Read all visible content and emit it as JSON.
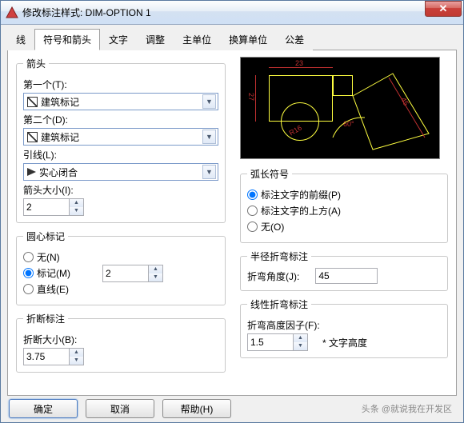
{
  "window": {
    "title": "修改标注样式: DIM-OPTION 1"
  },
  "tabs": [
    "线",
    "符号和箭头",
    "文字",
    "调整",
    "主单位",
    "换算单位",
    "公差"
  ],
  "active_tab": 1,
  "arrow": {
    "legend": "箭头",
    "first_label": "第一个(T):",
    "first_value": "建筑标记",
    "second_label": "第二个(D):",
    "second_value": "建筑标记",
    "leader_label": "引线(L):",
    "leader_value": "实心闭合",
    "size_label": "箭头大小(I):",
    "size_value": "2"
  },
  "center": {
    "legend": "圆心标记",
    "none": "无(N)",
    "mark": "标记(M)",
    "line": "直线(E)",
    "value": "2"
  },
  "break": {
    "legend": "折断标注",
    "size_label": "折断大小(B):",
    "size_value": "3.75"
  },
  "arc": {
    "legend": "弧长符号",
    "pre": "标注文字的前缀(P)",
    "above": "标注文字的上方(A)",
    "none": "无(O)"
  },
  "radjog": {
    "legend": "半径折弯标注",
    "angle_label": "折弯角度(J):",
    "angle_value": "45"
  },
  "linjog": {
    "legend": "线性折弯标注",
    "factor_label": "折弯高度因子(F):",
    "factor_value": "1.5",
    "suffix": "* 文字高度"
  },
  "buttons": {
    "ok": "确定",
    "cancel": "取消",
    "help": "帮助(H)"
  },
  "preview_dims": {
    "top": "23",
    "left": "27",
    "r": "R16",
    "ang": "60°",
    "diag": "45"
  },
  "watermark": "头条 @就说我在开发区"
}
